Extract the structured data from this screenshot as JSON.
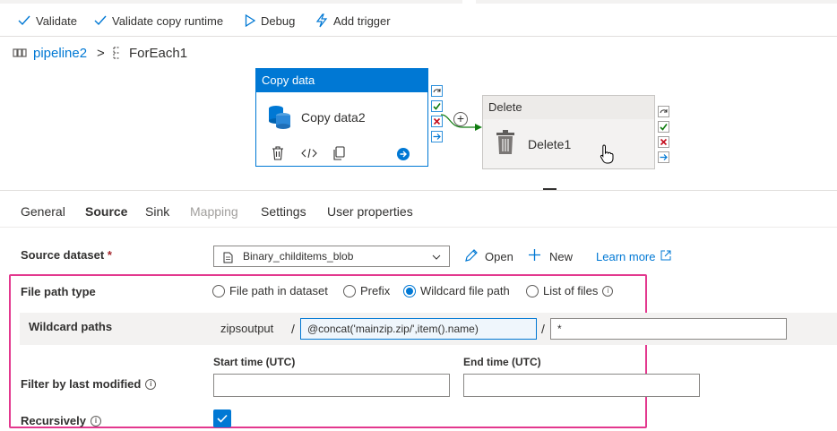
{
  "toolbar": {
    "validate_label": "Validate",
    "validate_copy_runtime_label": "Validate copy runtime",
    "debug_label": "Debug",
    "add_trigger_label": "Add trigger"
  },
  "breadcrumb": {
    "pipeline": "pipeline2",
    "separator": ">",
    "activity": "ForEach1"
  },
  "canvas": {
    "copy_activity": {
      "header": "Copy data",
      "name": "Copy data2"
    },
    "delete_activity": {
      "header": "Delete",
      "name": "Delete1"
    },
    "add_symbol": "+"
  },
  "tabs": [
    {
      "label": "General"
    },
    {
      "label": "Source"
    },
    {
      "label": "Sink"
    },
    {
      "label": "Mapping"
    },
    {
      "label": "Settings"
    },
    {
      "label": "User properties"
    }
  ],
  "source": {
    "dataset_label": "Source dataset",
    "required_mark": "*",
    "dataset_value": "Binary_childitems_blob",
    "open_label": "Open",
    "new_label": "New",
    "learn_more_label": "Learn more",
    "file_path_type_label": "File path type",
    "radio_options": [
      "File path in dataset",
      "Prefix",
      "Wildcard file path",
      "List of files"
    ],
    "selected_option": "Wildcard file path",
    "wildcard_paths_label": "Wildcard paths",
    "wildcard_container": "zipsoutput",
    "path_separator": "/",
    "wildcard_folder_value": "@concat('mainzip.zip/',item().name)",
    "wildcard_file_value": "*",
    "filter_label": "Filter by last modified",
    "start_time_label": "Start time (UTC)",
    "end_time_label": "End time (UTC)",
    "start_time_value": "",
    "end_time_value": "",
    "recursively_label": "Recursively",
    "recursively_checked": true,
    "info_glyph": "i"
  },
  "colors": {
    "accent": "#0078d4",
    "highlight_border": "#e3388e",
    "success": "#107c10",
    "error": "#c50f1f"
  }
}
